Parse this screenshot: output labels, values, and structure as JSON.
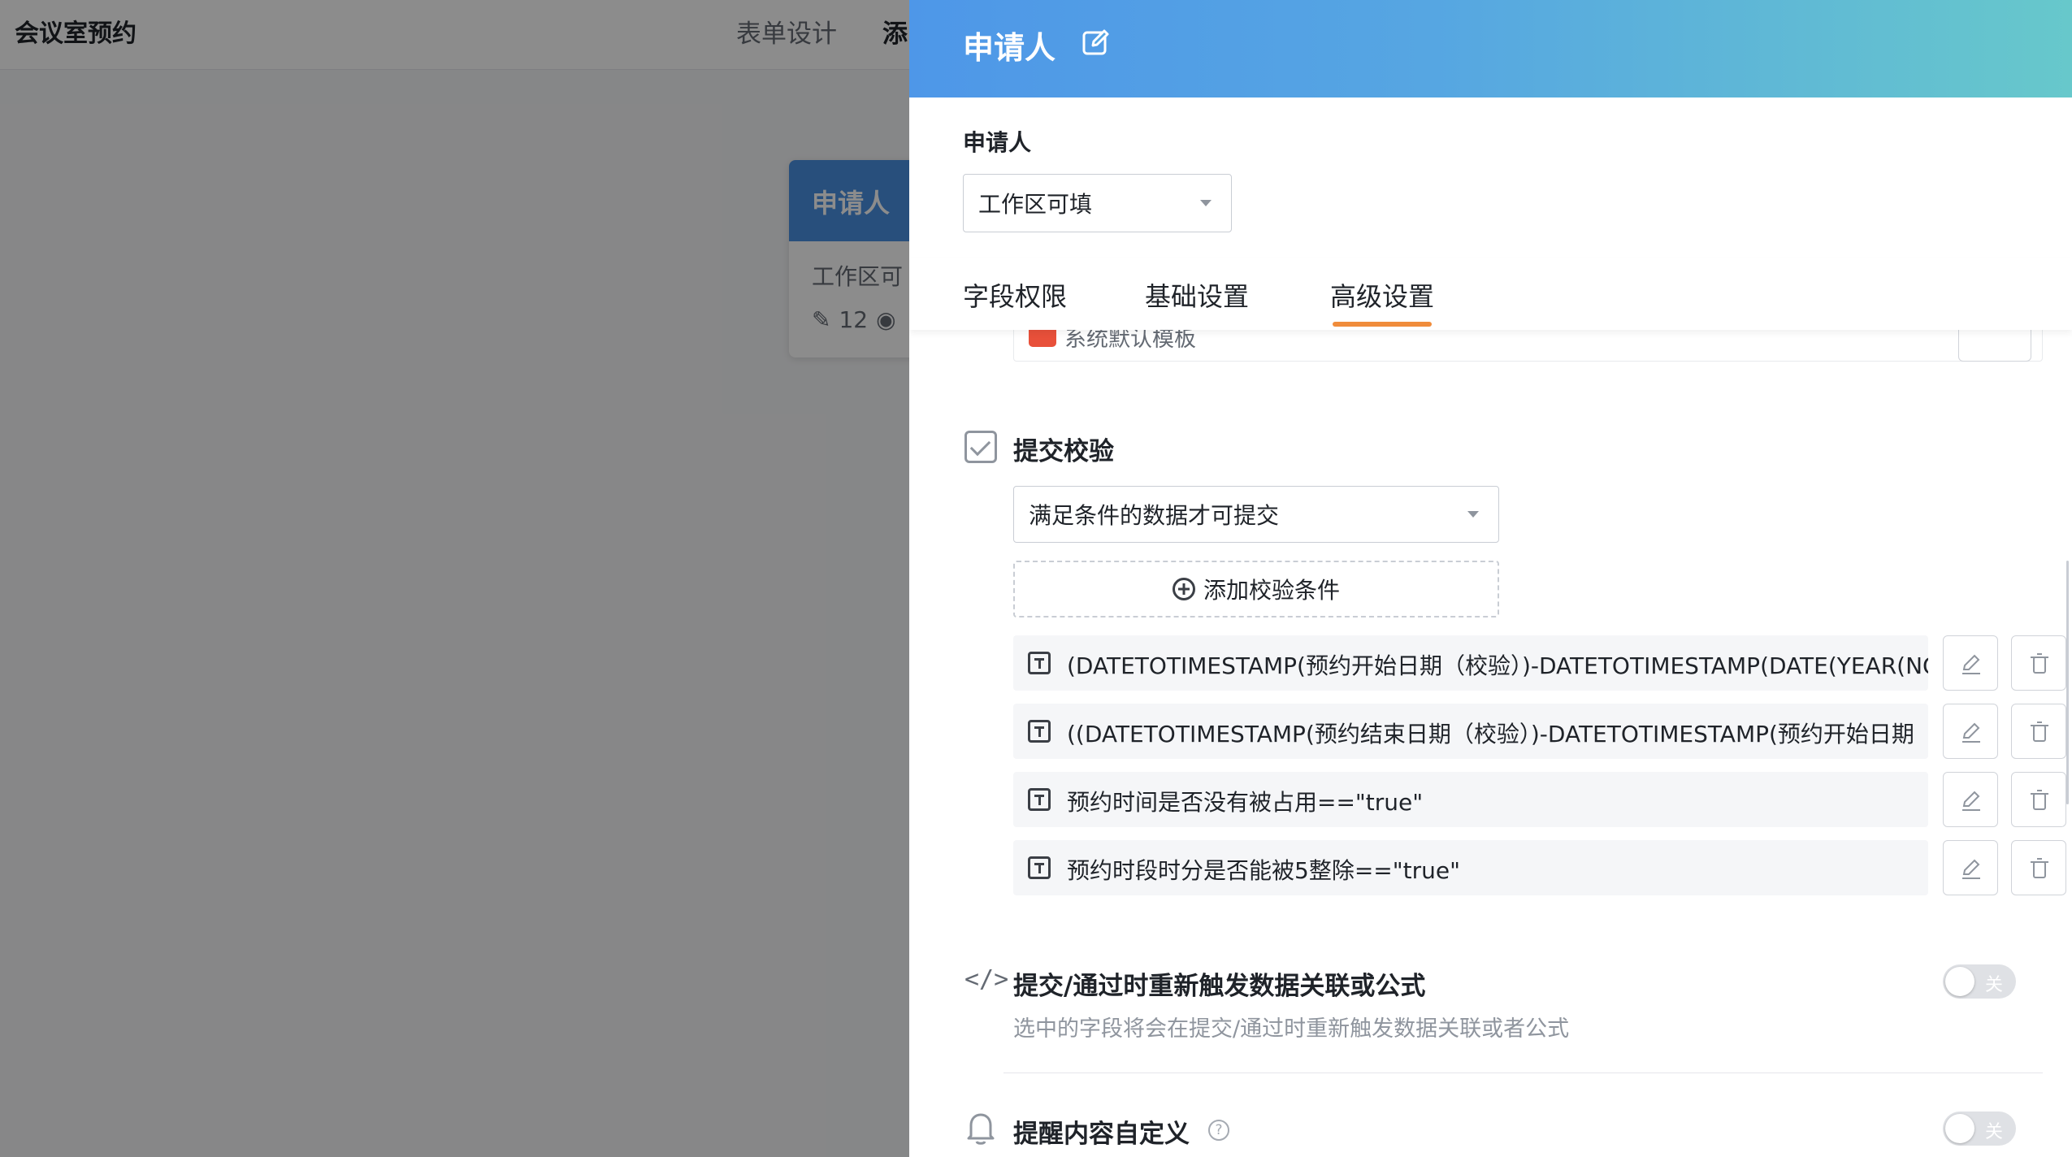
{
  "background": {
    "app_title": "会议室预约",
    "tabs": [
      "表单设计",
      "添"
    ],
    "card": {
      "title": "申请人",
      "subtitle": "工作区可",
      "count": "12"
    }
  },
  "drawer": {
    "title": "申请人",
    "field_label": "申请人",
    "permission_select": "工作区可填",
    "tabs": [
      "字段权限",
      "基础设置",
      "高级设置"
    ],
    "active_tab": "高级设置",
    "partial_row_text": "系统默认模板",
    "submit_validation": {
      "title": "提交校验",
      "mode_select": "满足条件的数据才可提交",
      "add_label": "添加校验条件",
      "conditions": [
        "(DATETOTIMESTAMP(预约开始日期（校验）)-DATETOTIMESTAMP(DATE(YEAR(NO",
        "((DATETOTIMESTAMP(预约结束日期（校验）)-DATETOTIMESTAMP(预约开始日期",
        "预约时间是否没有被占用==\"true\"",
        "预约时段时分是否能被5整除==\"true\""
      ]
    },
    "retrigger": {
      "title": "提交/通过时重新触发数据关联或公式",
      "description": "选中的字段将会在提交/通过时重新触发数据关联或者公式",
      "toggle_label": "关"
    },
    "reminder": {
      "title": "提醒内容自定义",
      "toggle_label": "关"
    }
  },
  "colors": {
    "accent_tab": "#f08c3b",
    "header_gradient_start": "#4e97e8",
    "header_gradient_end": "#67c8cb"
  }
}
